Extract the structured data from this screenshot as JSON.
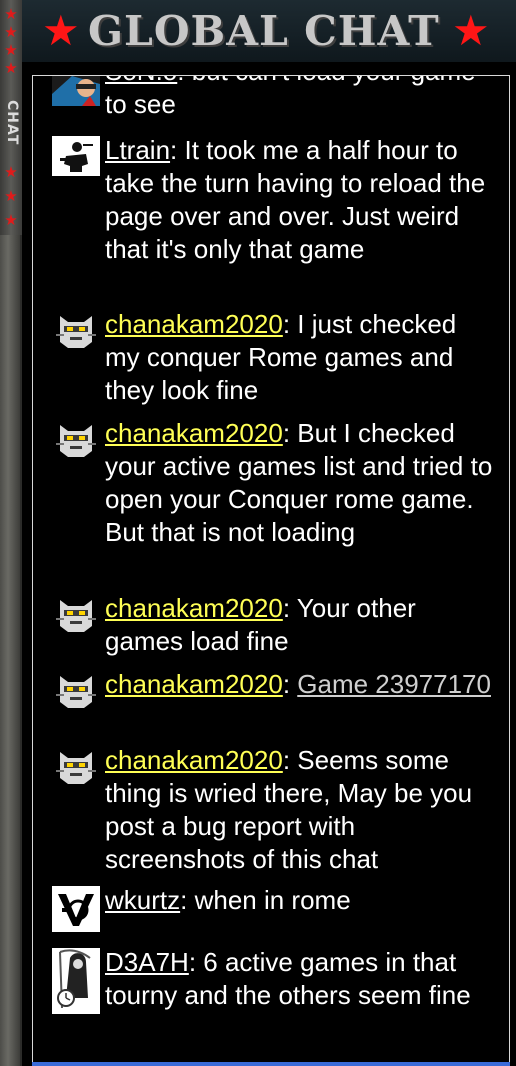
{
  "header": {
    "title": "GLOBAL CHAT"
  },
  "side_tab": {
    "label": "CHAT"
  },
  "messages": [
    {
      "user": "SoN.o",
      "separator": ": ",
      "text": "but can't load your game to see",
      "text_visible": "game to see",
      "avatar": "ninja-avatar-icon",
      "user_color": "#ffffff"
    },
    {
      "user": "Ltrain",
      "separator": ": ",
      "text": "It took me a half hour to take the turn having to reload the page over and over. Just weird that it's only that game",
      "avatar": "soldier-avatar-icon",
      "user_color": "#ffffff"
    },
    {
      "user": "chanakam2020",
      "separator": ": ",
      "text": "I just checked my conquer Rome games and they look fine",
      "avatar": "cat-avatar-icon",
      "user_color": "#ffff55"
    },
    {
      "user": "chanakam2020",
      "separator": ": ",
      "text": "But I checked your active games list and tried to open your Conquer rome game. But that is not loading",
      "avatar": "cat-avatar-icon",
      "user_color": "#ffff55"
    },
    {
      "user": "chanakam2020",
      "separator": ": ",
      "text": "Your other games load fine",
      "avatar": "cat-avatar-icon",
      "user_color": "#ffff55"
    },
    {
      "user": "chanakam2020",
      "separator": ": ",
      "text": "",
      "link_text": "Game 23977170",
      "avatar": "cat-avatar-icon",
      "user_color": "#ffff55"
    },
    {
      "user": "chanakam2020",
      "separator": ": ",
      "text": "Seems some thing is wried there, May be you post a bug report with screenshots of this chat",
      "avatar": "cat-avatar-icon",
      "user_color": "#ffff55"
    },
    {
      "user": "wkurtz",
      "separator": ": ",
      "text": "when in rome",
      "avatar": "vc-logo-avatar-icon",
      "user_color": "#ffffff"
    },
    {
      "user": "D3A7H",
      "separator": ": ",
      "text": "6 active games in that tourny and the others seem fine",
      "avatar": "reaper-avatar-icon",
      "user_color": "#ffffff"
    }
  ]
}
